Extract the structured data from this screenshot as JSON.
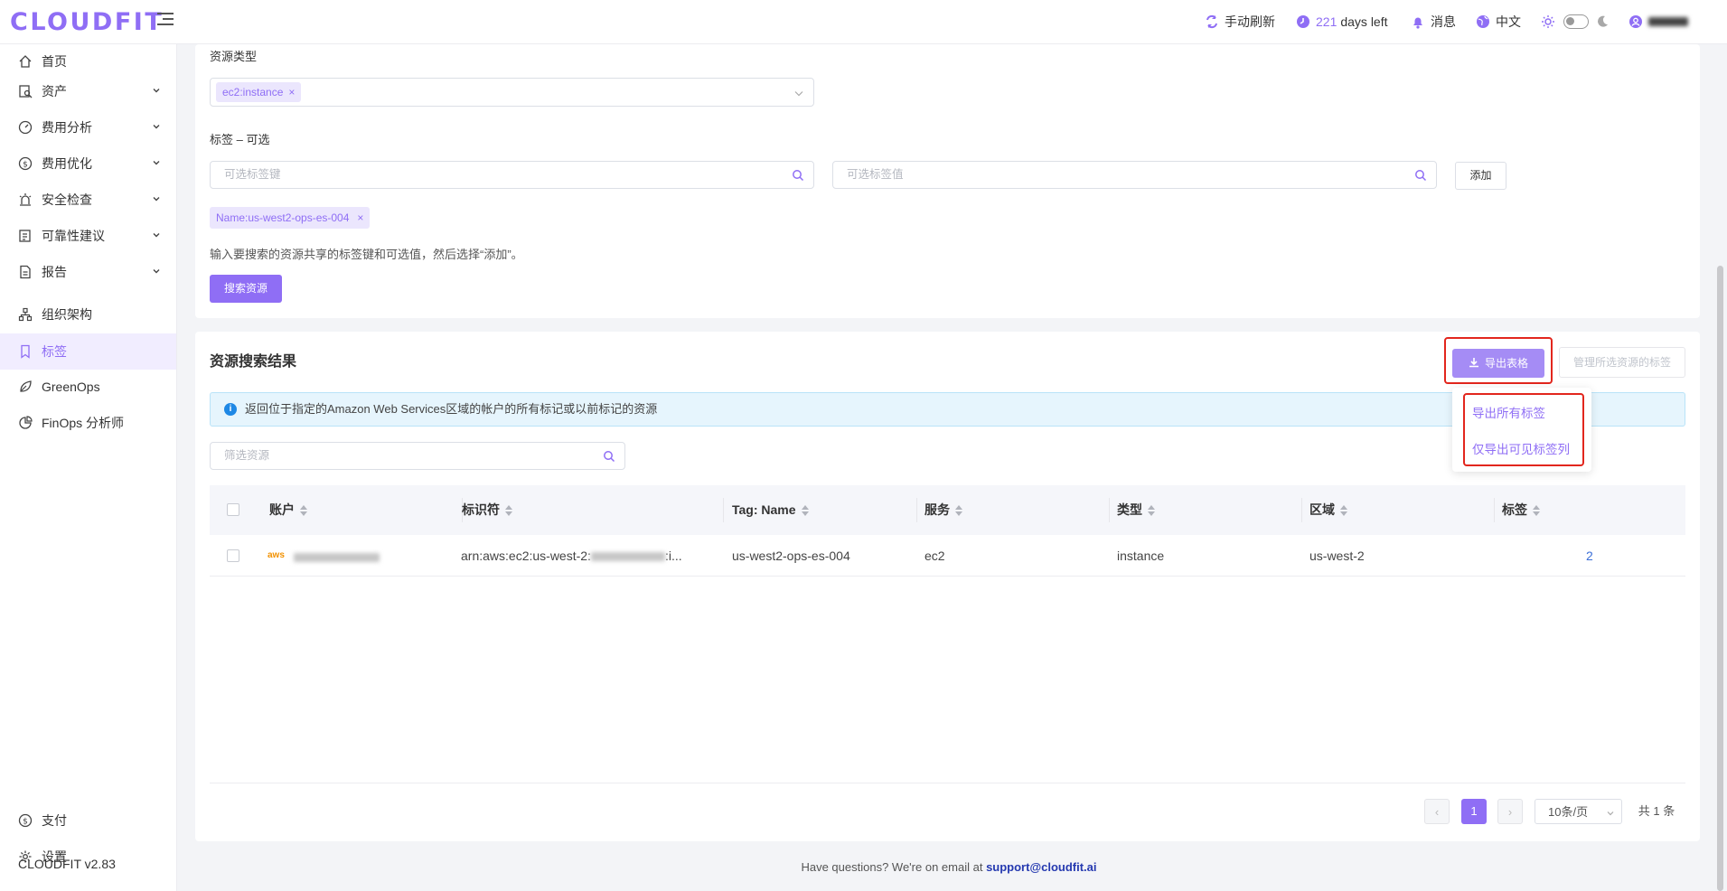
{
  "app": {
    "logo": "CLOUDFIT",
    "version": "CLOUDFIT v2.83"
  },
  "topbar": {
    "refresh": "手动刷新",
    "trial_days": "221",
    "trial_suffix": "days left",
    "messages": "消息",
    "language": "中文"
  },
  "sidebar": {
    "items": [
      {
        "label": "首页",
        "icon": "home-icon"
      },
      {
        "label": "资产",
        "icon": "asset-icon"
      },
      {
        "label": "费用分析",
        "icon": "gauge-icon"
      },
      {
        "label": "费用优化",
        "icon": "dollar-icon"
      },
      {
        "label": "安全检查",
        "icon": "alarm-icon"
      },
      {
        "label": "可靠性建议",
        "icon": "checklist-icon"
      },
      {
        "label": "报告",
        "icon": "report-icon"
      },
      {
        "label": "组织架构",
        "icon": "org-icon"
      },
      {
        "label": "标签",
        "icon": "tag-icon"
      },
      {
        "label": "GreenOps",
        "icon": "leaf-icon"
      },
      {
        "label": "FinOps 分析师",
        "icon": "analyst-icon"
      }
    ],
    "bottom": [
      {
        "label": "支付",
        "icon": "dollar-icon"
      },
      {
        "label": "设置",
        "icon": "gear-icon"
      }
    ]
  },
  "search_form": {
    "resource_type_label": "资源类型",
    "resource_type_chip": "ec2:instance",
    "tag_label": "标签 – 可选",
    "tag_key_placeholder": "可选标签键",
    "tag_value_placeholder": "可选标签值",
    "add_button": "添加",
    "tag_chip": "Name:us-west2-ops-es-004",
    "hint": "输入要搜索的资源共享的标签键和可选值，然后选择“添加”。",
    "search_button": "搜索资源"
  },
  "results": {
    "title": "资源搜索结果",
    "export_button": "导出表格",
    "manage_button": "管理所选资源的标签",
    "dropdown": [
      "导出所有标签",
      "仅导出可见标签列"
    ],
    "alert": "返回位于指定的Amazon Web Services区域的帐户的所有标记或以前标记的资源",
    "filter_placeholder": "筛选资源",
    "columns": [
      "账户",
      "标识符",
      "Tag: Name",
      "服务",
      "类型",
      "区域",
      "标签"
    ],
    "rows": [
      {
        "account_logo": "aws",
        "identifier_prefix": "arn:aws:ec2:us-west-2:",
        "identifier_suffix": ":i...",
        "tag_name": "us-west2-ops-es-004",
        "service": "ec2",
        "type": "instance",
        "region": "us-west-2",
        "tags": "2"
      }
    ],
    "pagination": {
      "current_page": "1",
      "page_size": "10条/页",
      "total": "共 1 条"
    }
  },
  "footer": {
    "text": "Have questions? We're on email at",
    "email": "support@cloudfit.ai"
  },
  "colors": {
    "accent": "#8f6ef5",
    "highlight": "#e2261d",
    "alert_bg": "#e6f5fd"
  }
}
